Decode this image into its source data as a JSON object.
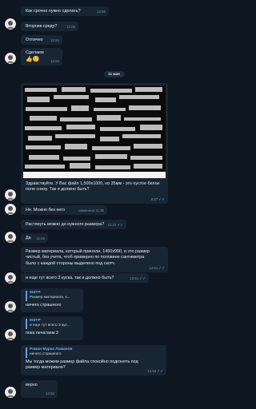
{
  "messages": {
    "m1": {
      "text": "Как срочно нужно сделать?",
      "time": "12:02"
    },
    "m2": {
      "text": "Вторник-среду?",
      "time": "12:06"
    },
    "m3": {
      "text": "Отлично",
      "time": "12:24"
    },
    "m4": {
      "text": "Сделаем",
      "emoji": "👍🙂",
      "time": "12:24"
    },
    "date": "11 мая",
    "m5": {
      "text": "Здравствуйте. У Вас файл 1,500x1000, но 35мм - это пустое белое поле снизу. Так и должно быть?",
      "time": "9:57"
    },
    "m6": {
      "text": "Не. Можно без него",
      "status": "изменено",
      "time": "11:35"
    },
    "m7": {
      "text": "Растянуть можно до нужного размера?",
      "time": "11:47"
    },
    "m8": {
      "text": "Да",
      "time": "11:48"
    },
    "m9": {
      "text": "Размер материала, который приняли, 1450x990, и это размер чистый, без учета, чтоб примерно по половине сантиметра было с каждой стороны выделено под скотч",
      "time": "12:51"
    },
    "m10": {
      "text": "и еще тут всего 3 куска, так и должно быть?",
      "time": "12:51"
    },
    "m11": {
      "reply_name": "МЭТР",
      "reply_text": "Размер материала, к...",
      "text": "ничего страшного"
    },
    "m12": {
      "reply_name": "МЭТР",
      "reply_text": "и еще тут всего 3 кус...",
      "text": "пока печатаем 3"
    },
    "m13": {
      "reply_name": "Роман Мурка Ломанов",
      "reply_text": "ничего страшного",
      "text": "Мы тогда можем размер файла спокойно подгонять под размер материала?",
      "time": "12:52"
    },
    "m14": {
      "text": "верно",
      "time": "12:52"
    }
  },
  "colors": {
    "background": "#0e1621",
    "incoming": "#182533",
    "outgoing": "#2b5278",
    "accent": "#6ab3f3"
  }
}
